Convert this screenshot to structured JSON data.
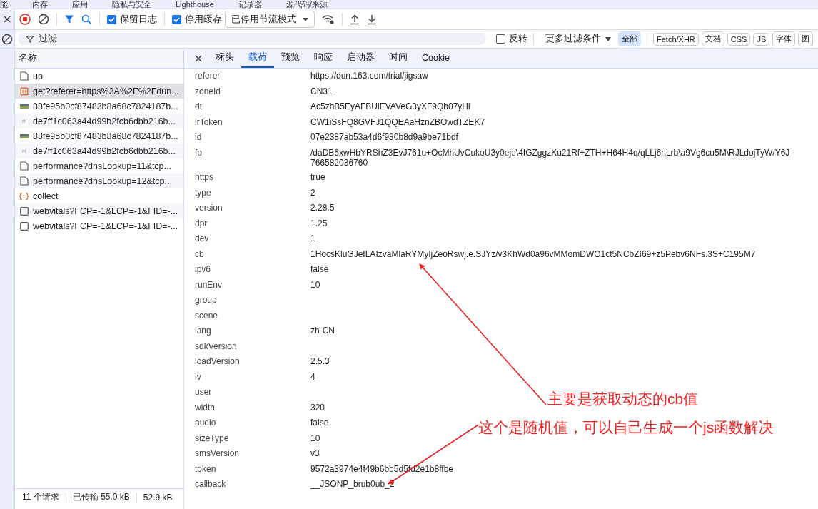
{
  "top_tabs": [
    "能",
    "内存",
    "应用",
    "隐私与安全",
    "Lighthouse",
    "记录器",
    "源代码/来源"
  ],
  "toolbar": {
    "checkboxes": [
      {
        "label": "保留日志",
        "checked": true
      },
      {
        "label": "停用缓存",
        "checked": true
      }
    ],
    "throttle": {
      "value": "已停用节流模式"
    }
  },
  "filter_bar": {
    "placeholder": "过滤",
    "invert": {
      "label": "反转",
      "checked": false
    },
    "more_filters": "更多过滤条件",
    "chips": [
      {
        "label": "全部",
        "selected": true
      },
      {
        "label": "Fetch/XHR",
        "selected": false
      },
      {
        "label": "文档",
        "selected": false
      },
      {
        "label": "CSS",
        "selected": false
      },
      {
        "label": "JS",
        "selected": false
      },
      {
        "label": "字体",
        "selected": false
      },
      {
        "label": "图",
        "selected": false
      }
    ]
  },
  "requests": {
    "column": "名称",
    "items": [
      {
        "name": "up",
        "kind": "document",
        "selected": false
      },
      {
        "name": "get?referer=https%3A%2F%2Fdun...",
        "kind": "jsonp",
        "selected": true
      },
      {
        "name": "88fe95b0cf87483b8a68c7824187b...",
        "kind": "image",
        "selected": false
      },
      {
        "name": "de7ff1c063a44d99b2fcb6dbb216b...",
        "kind": "other",
        "selected": false
      },
      {
        "name": "88fe95b0cf87483b8a68c7824187b...",
        "kind": "image",
        "selected": false
      },
      {
        "name": "de7ff1c063a44d99b2fcb6dbb216b...",
        "kind": "other",
        "selected": false
      },
      {
        "name": "performance?dnsLookup=11&tcp...",
        "kind": "document",
        "selected": false
      },
      {
        "name": "performance?dnsLookup=12&tcp...",
        "kind": "document",
        "selected": false
      },
      {
        "name": "collect",
        "kind": "script",
        "selected": false
      },
      {
        "name": "webvitals?FCP=-1&LCP=-1&FID=-...",
        "kind": "blank",
        "selected": false
      },
      {
        "name": "webvitals?FCP=-1&LCP=-1&FID=-...",
        "kind": "blank",
        "selected": false
      }
    ]
  },
  "detail_tabs": [
    {
      "label": "标头",
      "selected": false
    },
    {
      "label": "载荷",
      "selected": true
    },
    {
      "label": "预览",
      "selected": false
    },
    {
      "label": "响应",
      "selected": false
    },
    {
      "label": "启动器",
      "selected": false
    },
    {
      "label": "时间",
      "selected": false
    },
    {
      "label": "Cookie",
      "selected": false
    }
  ],
  "payload": [
    {
      "key": "referer",
      "value": "https://dun.163.com/trial/jigsaw"
    },
    {
      "key": "zoneId",
      "value": "CN31"
    },
    {
      "key": "dt",
      "value": "Ac5zhB5EyAFBUlEVAVeG3yXF9Qb07yHi"
    },
    {
      "key": "irToken",
      "value": "CW1iSsFQ8GVFJ1QQEAaHznZBOwdTZEK7"
    },
    {
      "key": "id",
      "value": "07e2387ab53a4d6f930b8d9a9be71bdf"
    },
    {
      "key": "fp",
      "value": "/daDB6xwHbYRShZ3EvJ761u+OcMhUvCukoU3y0eje\\4IGZggzKu21Rf+ZTH+H64H4q/qLLj6nLrb\\a9Vg6cu5M\\RJLdojTyW/Y6J",
      "value_continued": "766582036760"
    },
    {
      "key": "https",
      "value": "true"
    },
    {
      "key": "type",
      "value": "2"
    },
    {
      "key": "version",
      "value": "2.28.5"
    },
    {
      "key": "dpr",
      "value": "1.25"
    },
    {
      "key": "dev",
      "value": "1"
    },
    {
      "key": "cb",
      "value": "1HocsKluGJeILAIzvaMlaRYMyIjZeoRswj.e.SJYz/v3KhWd0a96vMMomDWO1ct5NCbZI69+z5Pebv6NFs.3S+C195M7"
    },
    {
      "key": "ipv6",
      "value": "false"
    },
    {
      "key": "runEnv",
      "value": "10"
    },
    {
      "key": "group"
    },
    {
      "key": "scene"
    },
    {
      "key": "lang",
      "value": "zh-CN"
    },
    {
      "key": "sdkVersion"
    },
    {
      "key": "loadVersion",
      "value": "2.5.3"
    },
    {
      "key": "iv",
      "value": "4"
    },
    {
      "key": "user"
    },
    {
      "key": "width",
      "value": "320"
    },
    {
      "key": "audio",
      "value": "false"
    },
    {
      "key": "sizeType",
      "value": "10"
    },
    {
      "key": "smsVersion",
      "value": "v3"
    },
    {
      "key": "token",
      "value": "9572a3974e4f49b6bb5d5fd2e1b8ffbe"
    },
    {
      "key": "callback",
      "value": "__JSONP_brub0ub_2"
    }
  ],
  "status_bar": [
    "11 个请求",
    "已传输 55.0 kB",
    "52.9 kB"
  ],
  "annotations": [
    "主要是获取动态的cb值",
    "这个是随机值，可以自己生成一个js函数解决"
  ]
}
